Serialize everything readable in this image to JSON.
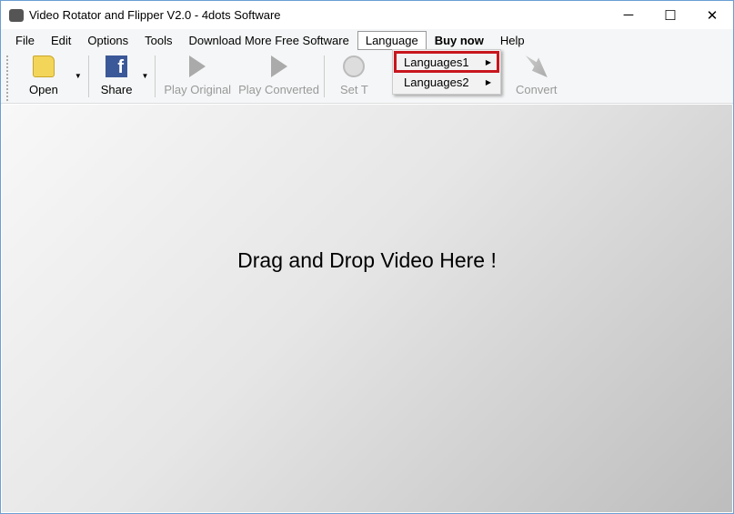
{
  "window": {
    "title": "Video Rotator and Flipper V2.0 - 4dots Software",
    "minimize": "─",
    "maximize": "☐",
    "close": "✕"
  },
  "menu": [
    "File",
    "Edit",
    "Options",
    "Tools",
    "Download More Free Software",
    "Language",
    "Buy now",
    "Help"
  ],
  "toolbar": {
    "open": "Open",
    "share": "Share",
    "play_original": "Play Original",
    "play_converted": "Play Converted",
    "set_time": "Set T",
    "convert": "Convert",
    "fb_letter": "f"
  },
  "language_menu": [
    "Languages1",
    "Languages2"
  ],
  "main": {
    "drop_text": "Drag and Drop Video Here !"
  }
}
